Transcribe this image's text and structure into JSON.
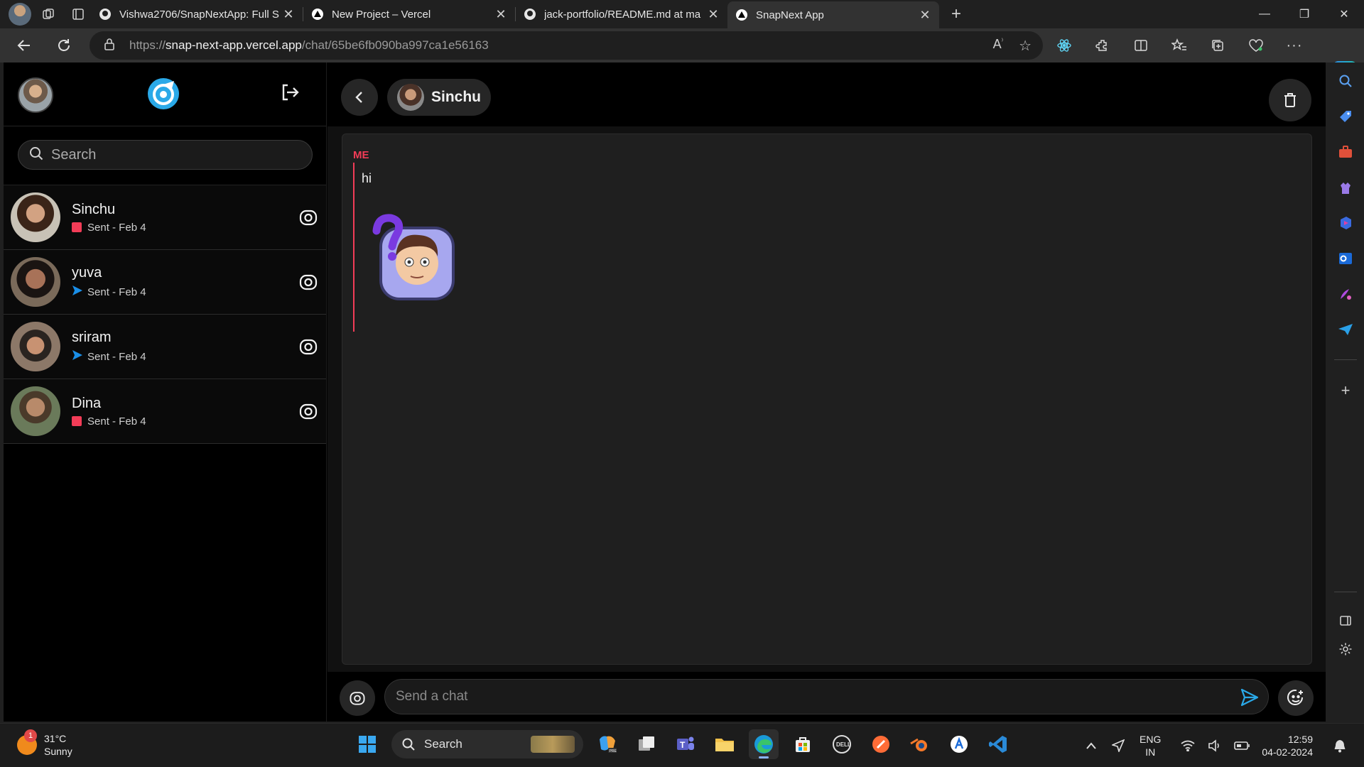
{
  "browser": {
    "tabs": [
      {
        "title": "Vishwa2706/SnapNextApp: Full S",
        "icon": "github-icon"
      },
      {
        "title": "New Project – Vercel",
        "icon": "vercel-icon"
      },
      {
        "title": "jack-portfolio/README.md at ma",
        "icon": "github-icon"
      },
      {
        "title": "SnapNext App",
        "icon": "vercel-icon",
        "active": true
      }
    ],
    "url_scheme": "https://",
    "url_host": "snap-next-app.vercel.app",
    "url_path": "/chat/65be6fb090ba997ca1e56163"
  },
  "sidebar": {
    "search_placeholder": "Search",
    "chats": [
      {
        "name": "Sinchu",
        "status": "Sent - Feb 4",
        "status_icon": "red-square"
      },
      {
        "name": "yuva",
        "status": "Sent - Feb 4",
        "status_icon": "blue-arrow"
      },
      {
        "name": "sriram",
        "status": "Sent - Feb 4",
        "status_icon": "blue-arrow"
      },
      {
        "name": "Dina",
        "status": "Sent - Feb 4",
        "status_icon": "red-square"
      }
    ]
  },
  "chat": {
    "recipient": "Sinchu",
    "messages": [
      {
        "sender_label": "ME",
        "text": "hi",
        "has_sticker": true
      }
    ],
    "input_placeholder": "Send a chat"
  },
  "taskbar": {
    "weather_temp": "31°C",
    "weather_desc": "Sunny",
    "weather_badge": "1",
    "search_label": "Search",
    "lang_line1": "ENG",
    "lang_line2": "IN",
    "time": "12:59",
    "date": "04-02-2024"
  },
  "colors": {
    "accent_red": "#f23c57",
    "accent_blue": "#2aa9e8",
    "sent_arrow": "#1a8fe8"
  }
}
